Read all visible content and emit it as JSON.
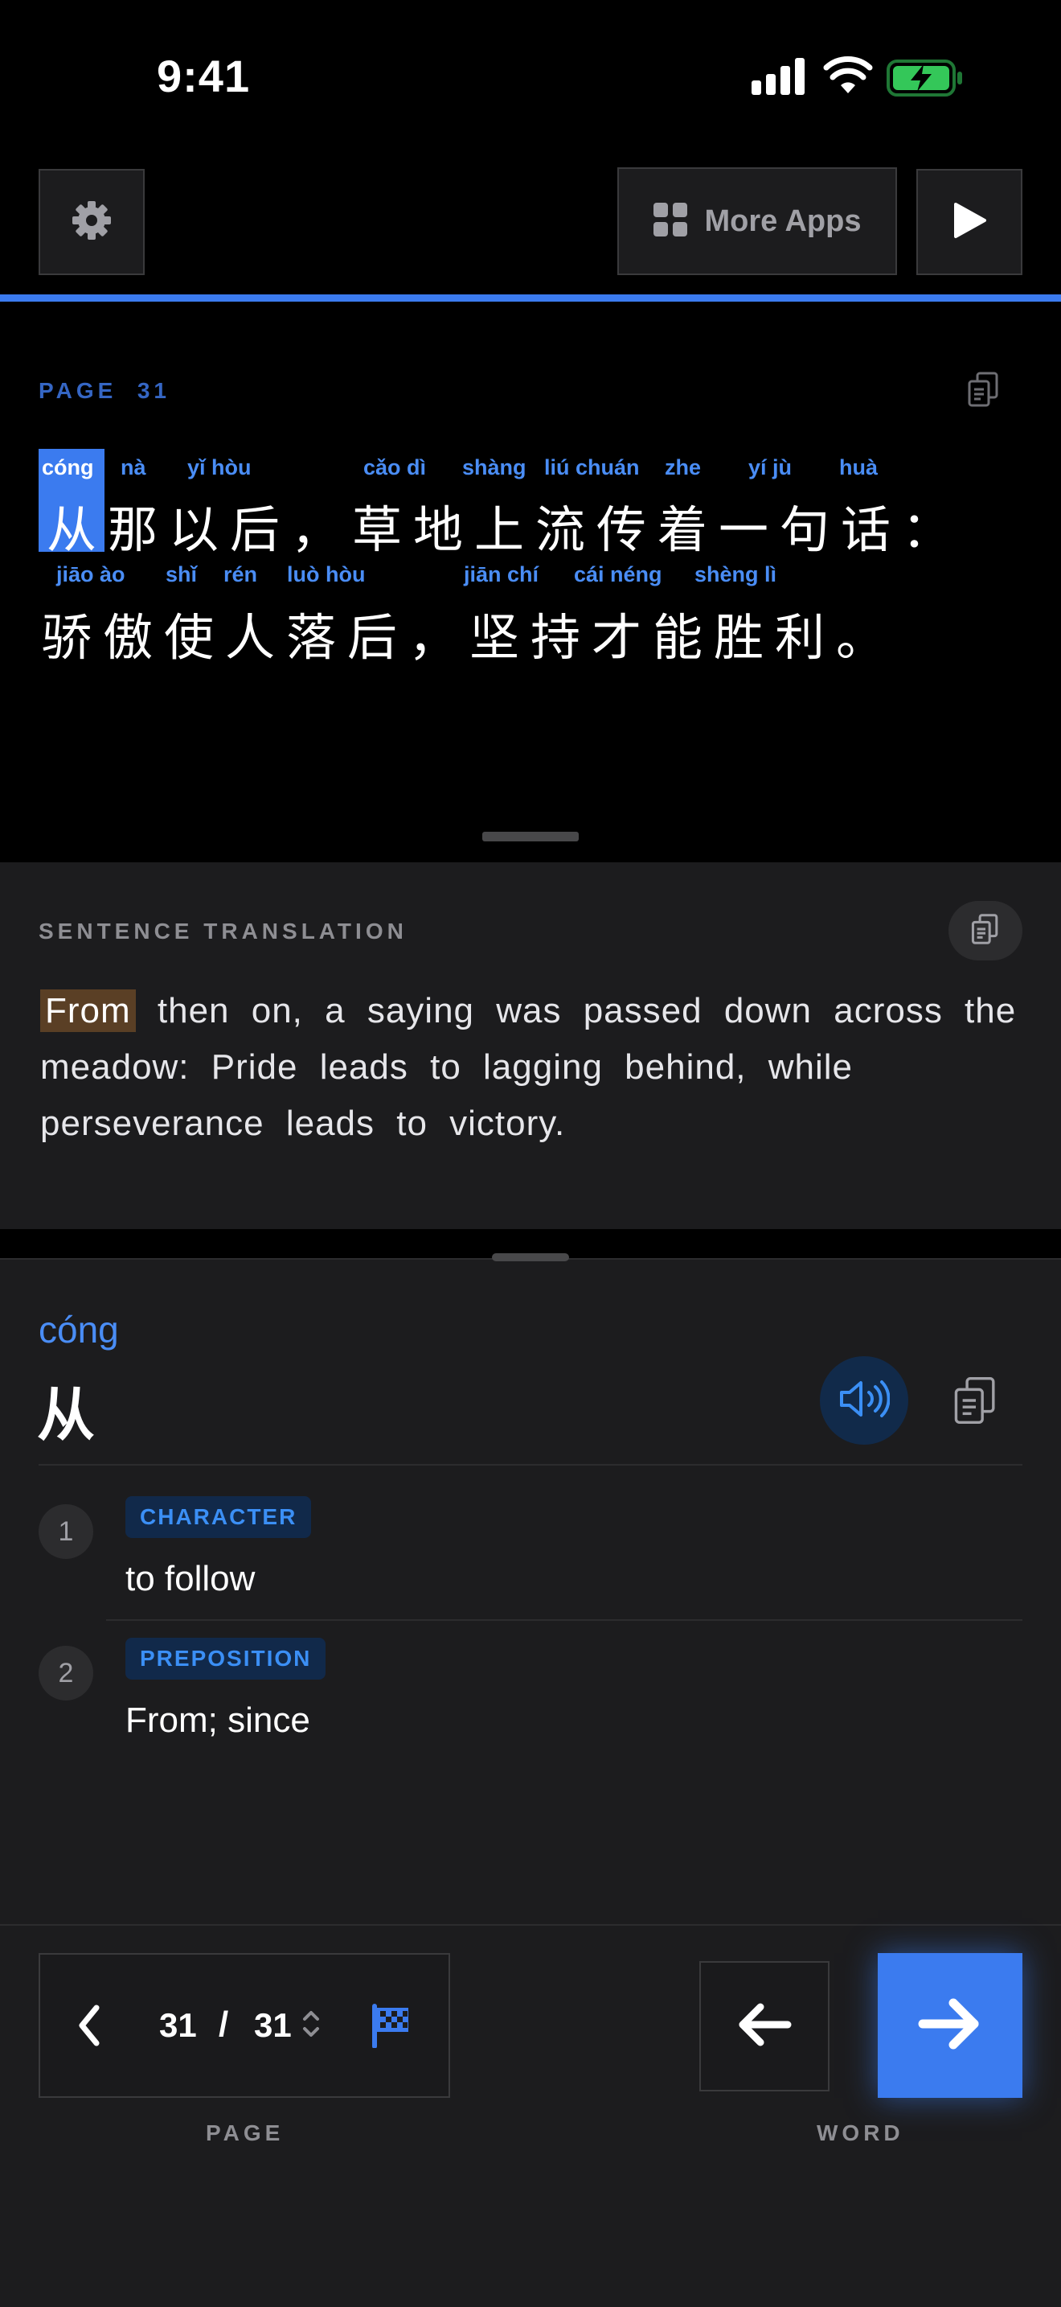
{
  "status_bar": {
    "time": "9:41"
  },
  "toolbar": {
    "more_apps_label": "More Apps"
  },
  "reader": {
    "page_label": "PAGE  31",
    "line1": {
      "hanzi": "从那以后，草地上流传着一句话：",
      "selected_char": "从"
    },
    "line2": {
      "hanzi": "骄傲使人落后，坚持才能胜利。"
    },
    "pinyin_line1": [
      "cóng",
      "nà",
      "yǐ hòu",
      "cǎo dì",
      "shàng",
      "liú chuán",
      "zhe",
      "yí jù",
      "huà"
    ],
    "pinyin_line2": [
      "jiāo ào",
      "shǐ",
      "rén",
      "luò hòu",
      "jiān chí",
      "cái néng",
      "shèng lì"
    ]
  },
  "translation": {
    "heading": "SENTENCE TRANSLATION",
    "highlight": "From",
    "rest": " then on, a saying was passed down across the meadow: Pride leads to lagging behind, while perseverance leads to victory."
  },
  "word": {
    "pinyin": "cóng",
    "hanzi": "从",
    "definitions": [
      {
        "num": "1",
        "tag": "CHARACTER",
        "text": "to follow"
      },
      {
        "num": "2",
        "tag": "PREPOSITION",
        "text": "From; since"
      }
    ]
  },
  "nav": {
    "current_page": "31",
    "separator": "/",
    "total_pages": "31",
    "page_label": "PAGE",
    "word_label": "WORD"
  },
  "colors": {
    "accent": "#3b7bef",
    "pinyin": "#4a8df5",
    "highlight": "#5a3f25",
    "panel": "#1c1c1e"
  }
}
